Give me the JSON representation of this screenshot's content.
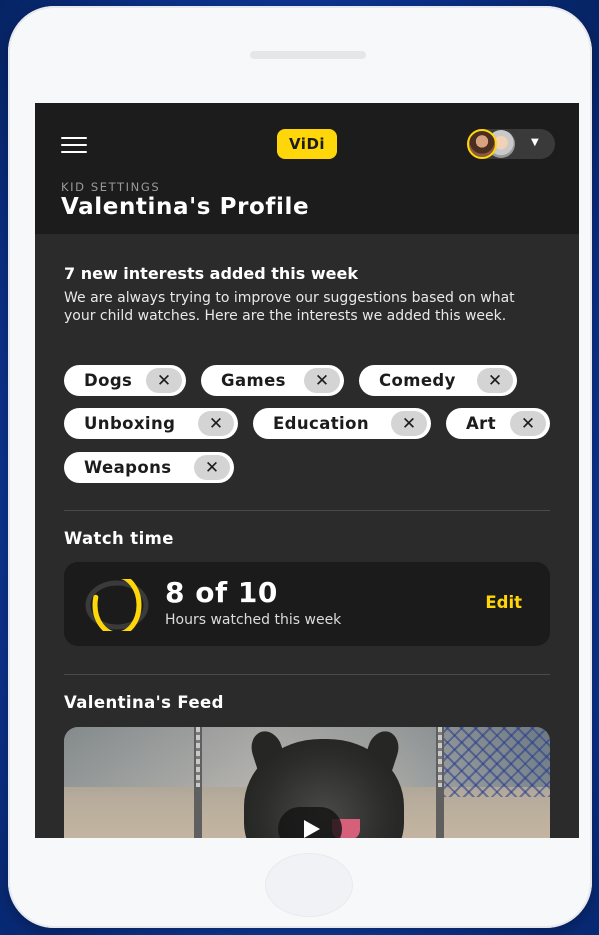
{
  "header": {
    "logo_text": "ViDi",
    "section_label": "KID SETTINGS",
    "title": "Valentina's Profile"
  },
  "interests": {
    "heading": "7 new interests added this week",
    "description": "We are always trying to improve our suggestions based on what your child watches. Here are the interests we added this week.",
    "remove_glyph": "✕",
    "items": [
      {
        "label": "Dogs"
      },
      {
        "label": "Games"
      },
      {
        "label": "Comedy"
      },
      {
        "label": "Unboxing"
      },
      {
        "label": "Education"
      },
      {
        "label": "Art"
      },
      {
        "label": "Weapons"
      }
    ]
  },
  "watch_time": {
    "heading": "Watch time",
    "value": "8 of 10",
    "hours_watched": 8,
    "hours_limit": 10,
    "caption": "Hours watched this week",
    "edit_label": "Edit"
  },
  "feed": {
    "heading": "Valentina's Feed"
  },
  "colors": {
    "accent": "#ffd60a",
    "header_bg": "#1c1c1c",
    "body_bg": "#2b2b2b",
    "chip_bg": "#ffffff",
    "chip_remove_bg": "#d4d4d4",
    "card_bg": "#1b1b1b",
    "page_bg": "#1246b3"
  },
  "icons": {
    "menu": "hamburger-menu-icon",
    "caret": "chevron-down-icon",
    "remove": "close-icon",
    "play": "play-icon"
  }
}
